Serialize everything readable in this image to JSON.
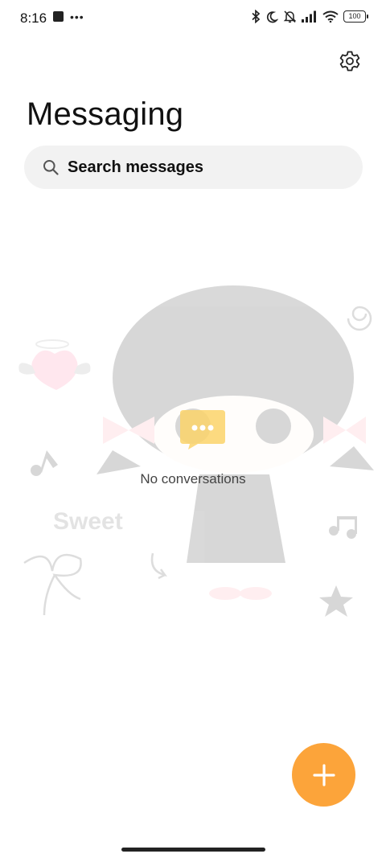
{
  "status_bar": {
    "time": "8:16",
    "battery": "100",
    "icons": [
      "stop-icon",
      "more-dots-icon",
      "bluetooth-icon",
      "moon-icon",
      "bell-off-icon",
      "signal-icon",
      "wifi-icon",
      "battery-icon"
    ]
  },
  "header": {
    "title": "Messaging",
    "settings_icon": "gear-icon"
  },
  "search": {
    "placeholder": "Search messages",
    "icon": "search-icon"
  },
  "empty_state": {
    "text": "No conversations",
    "icon": "chat-bubble-icon"
  },
  "background": {
    "decoration_text": "Sweet"
  },
  "fab": {
    "icon": "plus-icon",
    "color": "#fca43a"
  },
  "colors": {
    "accent": "#fca43a",
    "search_bg": "#f2f2f2"
  }
}
